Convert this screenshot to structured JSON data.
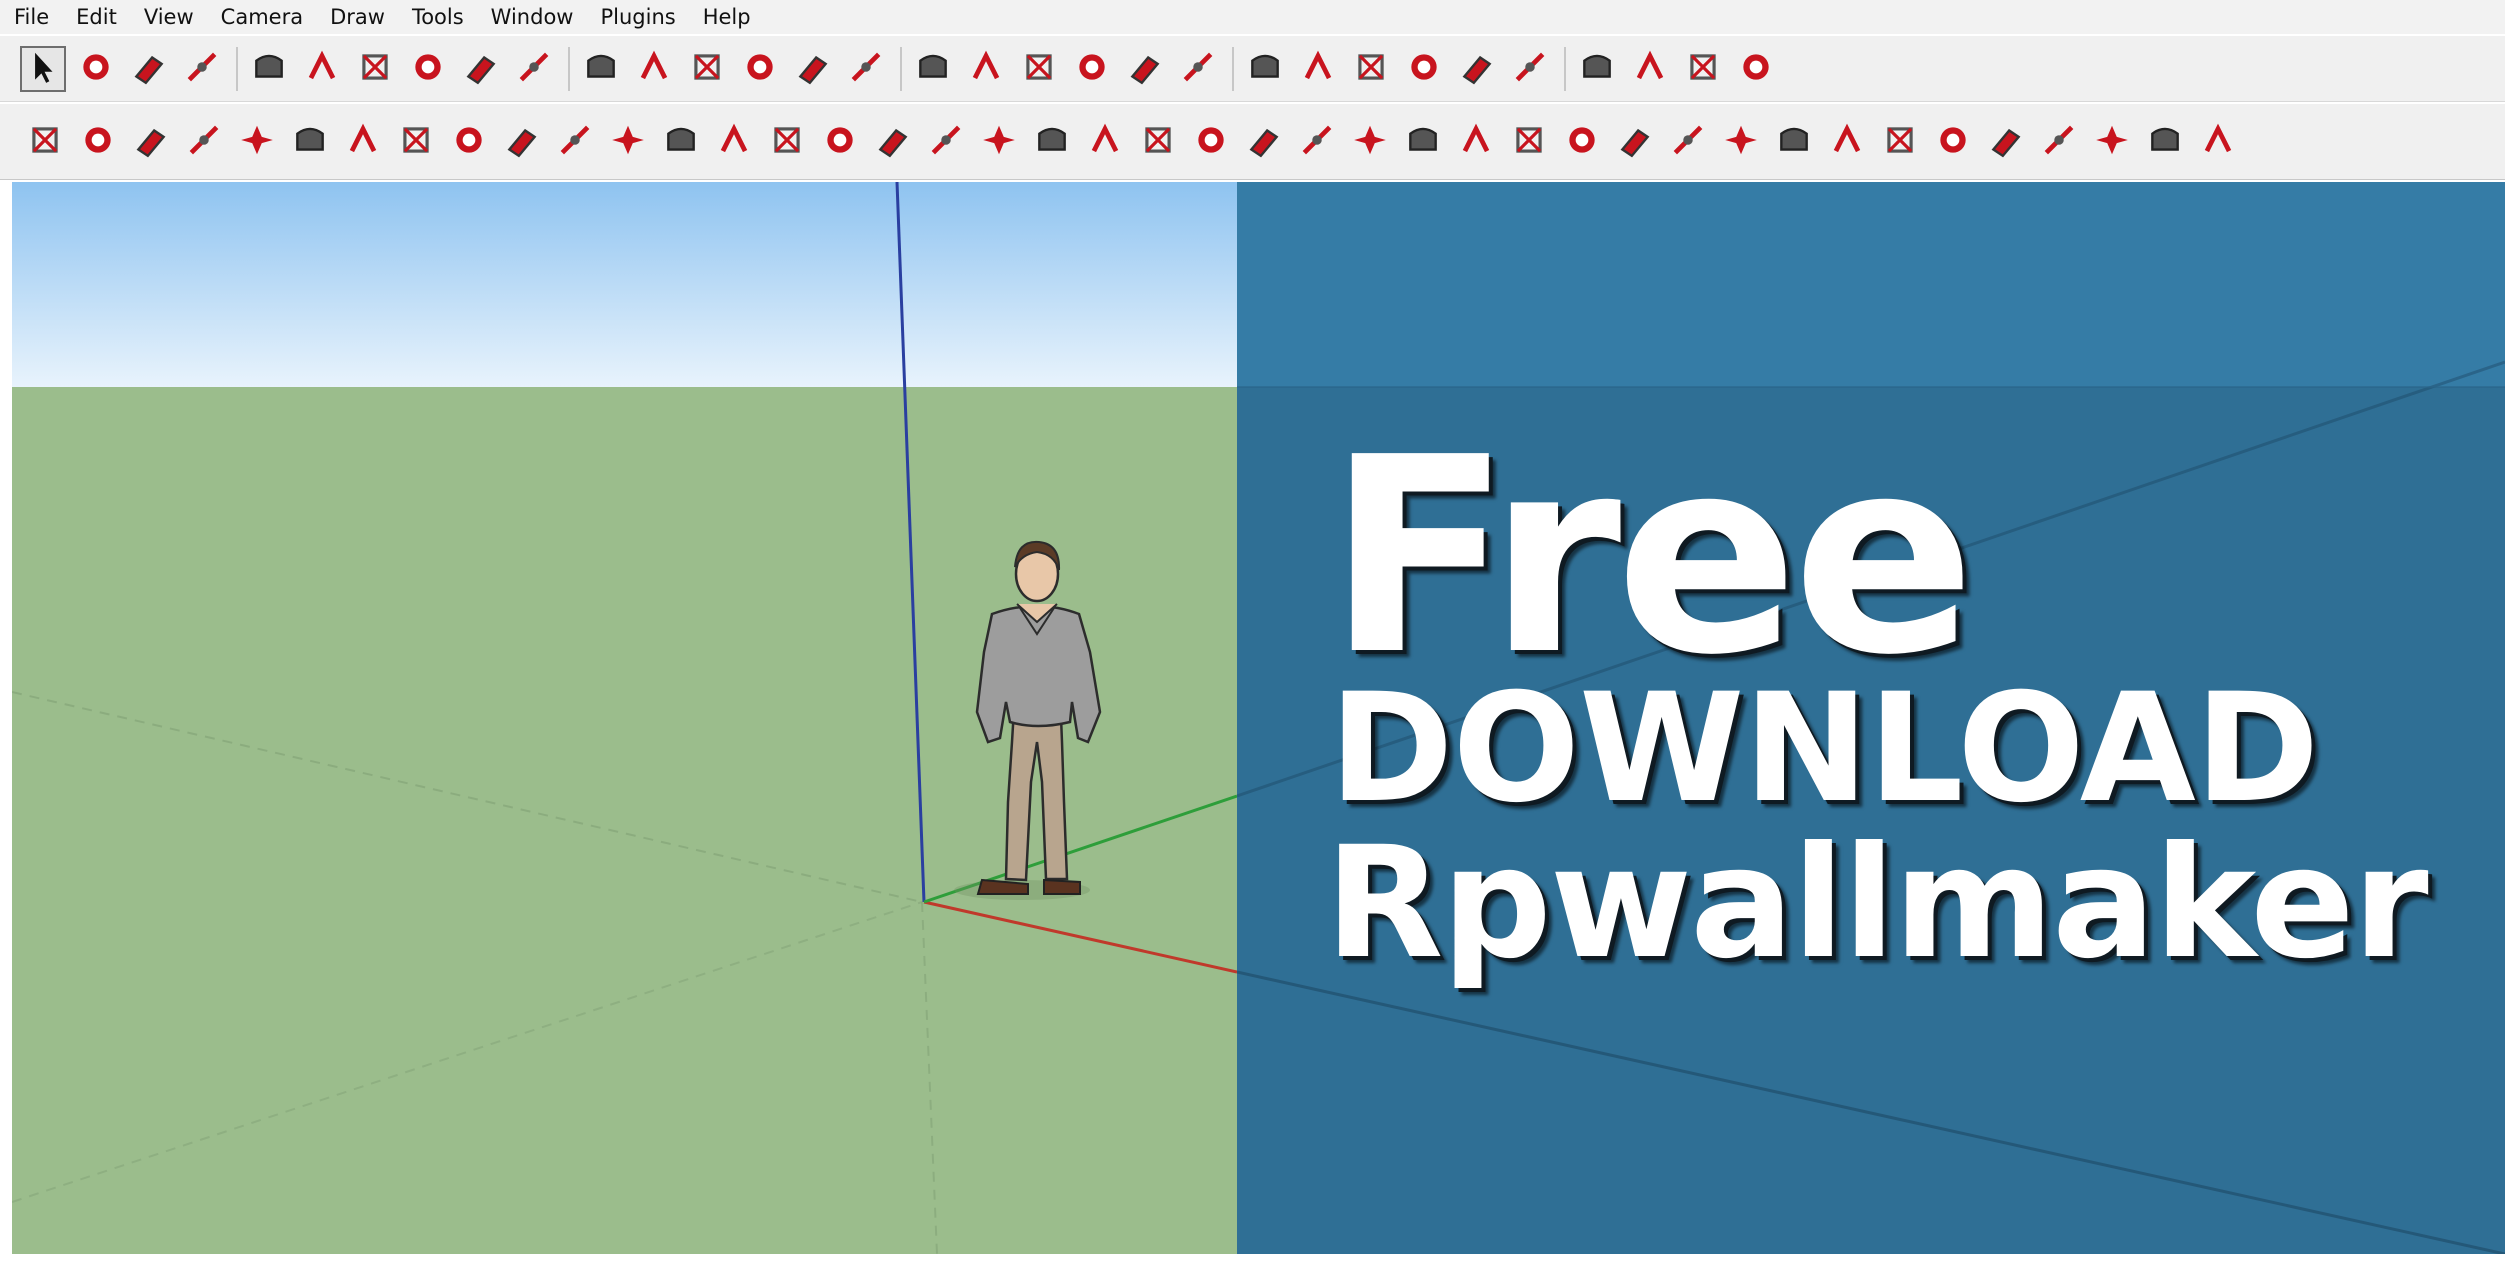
{
  "menu": {
    "items": [
      {
        "label": "File"
      },
      {
        "label": "Edit"
      },
      {
        "label": "View"
      },
      {
        "label": "Camera"
      },
      {
        "label": "Draw"
      },
      {
        "label": "Tools"
      },
      {
        "label": "Window"
      },
      {
        "label": "Plugins"
      },
      {
        "label": "Help"
      }
    ]
  },
  "toolbar_primary": {
    "tools": [
      {
        "icon": "select-arrow-icon",
        "active": true
      },
      {
        "icon": "make-component-icon"
      },
      {
        "icon": "paint-bucket-icon"
      },
      {
        "icon": "eraser-icon"
      },
      {
        "sep": true
      },
      {
        "icon": "rectangle-icon"
      },
      {
        "icon": "line-pencil-icon"
      },
      {
        "icon": "circle-icon"
      },
      {
        "icon": "arc-icon"
      },
      {
        "icon": "polygon-icon"
      },
      {
        "icon": "freehand-icon"
      },
      {
        "sep": true
      },
      {
        "icon": "move-icon"
      },
      {
        "icon": "push-pull-icon"
      },
      {
        "icon": "rotate-icon"
      },
      {
        "icon": "follow-me-icon"
      },
      {
        "icon": "scale-icon"
      },
      {
        "icon": "offset-icon"
      },
      {
        "sep": true
      },
      {
        "icon": "tape-measure-icon"
      },
      {
        "icon": "dimension-icon"
      },
      {
        "icon": "protractor-icon"
      },
      {
        "icon": "text-label-icon"
      },
      {
        "icon": "axes-icon"
      },
      {
        "icon": "3d-text-icon"
      },
      {
        "sep": true
      },
      {
        "icon": "orbit-icon"
      },
      {
        "icon": "pan-hand-icon"
      },
      {
        "icon": "zoom-icon"
      },
      {
        "icon": "zoom-window-icon"
      },
      {
        "icon": "zoom-extents-icon"
      },
      {
        "icon": "previous-view-icon"
      },
      {
        "sep": true
      },
      {
        "icon": "position-camera-icon"
      },
      {
        "icon": "look-around-icon"
      },
      {
        "icon": "walk-icon"
      },
      {
        "icon": "section-plane-icon"
      }
    ]
  },
  "toolbar_secondary": {
    "tools": [
      {
        "icon": "plugin-tool-1-icon"
      },
      {
        "icon": "plugin-tool-2-icon"
      },
      {
        "icon": "plugin-tool-3-icon"
      },
      {
        "icon": "plugin-tool-4-icon"
      },
      {
        "icon": "plugin-tool-5-icon"
      },
      {
        "icon": "plugin-tool-6-icon"
      },
      {
        "icon": "plugin-tool-7-icon"
      },
      {
        "icon": "plugin-tool-8-icon"
      },
      {
        "icon": "plugin-tool-9-icon"
      },
      {
        "icon": "plugin-tool-10-icon"
      },
      {
        "icon": "plugin-tool-11-icon"
      },
      {
        "icon": "plugin-tool-12-icon"
      },
      {
        "icon": "plugin-tool-13-icon"
      },
      {
        "icon": "plugin-tool-14-icon"
      },
      {
        "icon": "plugin-tool-15-icon"
      },
      {
        "icon": "plugin-tool-16-icon"
      },
      {
        "icon": "plugin-tool-17-icon"
      },
      {
        "icon": "plugin-tool-18-icon"
      },
      {
        "icon": "plugin-tool-19-icon"
      },
      {
        "icon": "plugin-tool-20-icon"
      },
      {
        "icon": "plugin-tool-21-icon"
      },
      {
        "icon": "plugin-tool-22-icon"
      },
      {
        "icon": "plugin-tool-23-icon"
      },
      {
        "icon": "plugin-tool-24-icon"
      },
      {
        "icon": "plugin-tool-25-icon"
      },
      {
        "icon": "plugin-tool-26-icon"
      },
      {
        "icon": "plugin-tool-27-icon"
      },
      {
        "icon": "plugin-tool-28-icon"
      },
      {
        "icon": "plugin-tool-29-icon"
      },
      {
        "icon": "plugin-tool-30-icon"
      },
      {
        "icon": "plugin-tool-31-icon"
      },
      {
        "icon": "plugin-tool-32-icon"
      },
      {
        "icon": "plugin-tool-33-icon"
      },
      {
        "icon": "plugin-tool-34-icon"
      },
      {
        "icon": "plugin-tool-35-icon"
      },
      {
        "icon": "plugin-tool-36-icon"
      },
      {
        "icon": "plugin-tool-37-icon"
      },
      {
        "icon": "plugin-tool-38-icon"
      },
      {
        "icon": "plugin-tool-39-icon"
      },
      {
        "icon": "plugin-tool-40-icon"
      },
      {
        "icon": "plugin-tool-41-icon"
      },
      {
        "icon": "plugin-tool-42-icon"
      }
    ]
  },
  "banner": {
    "line1": "Free",
    "line2": "DOWNLOAD",
    "line3": "Rpwallmaker"
  },
  "colors": {
    "sky_top": "#8ec3f0",
    "sky_bottom": "#e8f3fc",
    "ground": "#9bbd8c",
    "banner_bg": "#2f6f95",
    "banner_text": "#ffffff",
    "axis_red": "#c0392b",
    "axis_green": "#2e9e3a",
    "axis_blue": "#2a3fa0",
    "tool_red": "#c8141e",
    "tool_gray": "#555555"
  }
}
